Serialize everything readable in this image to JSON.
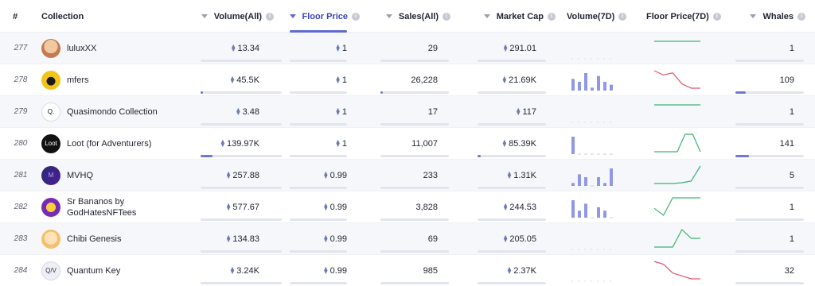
{
  "header": {
    "rank": "#",
    "collection": "Collection",
    "volume_all": "Volume(All)",
    "floor_price": "Floor Price",
    "sales_all": "Sales(All)",
    "market_cap": "Market Cap",
    "volume_7d": "Volume(7D)",
    "floor_price_7d": "Floor Price(7D)",
    "whales": "Whales",
    "info_glyph": "i"
  },
  "colors": {
    "accent": "#5e6ad2",
    "bar": "#6e78d6",
    "spark_up": "#3cb371",
    "spark_down": "#e0566b",
    "vol_bars": "#8f98e6"
  },
  "rows": [
    {
      "rank": "277",
      "name": "luluxXX",
      "avatar": "luluxXX-avatar",
      "volume": "13.34",
      "floor": "1",
      "sales": "29",
      "mcap": "291.01",
      "whales": "1",
      "volume_level": 0.0,
      "floor_level": 0.0,
      "sales_level": 0.0,
      "mcap_level": 0.0,
      "whales_level": 0.0,
      "vol7d": [],
      "floor7d": [
        1,
        1,
        1,
        1,
        1,
        1
      ],
      "trend": "up"
    },
    {
      "rank": "278",
      "name": "mfers",
      "avatar": "mfers-avatar",
      "volume": "45.5K",
      "floor": "1",
      "sales": "26,228",
      "mcap": "21.69K",
      "whales": "109",
      "volume_level": 0.03,
      "floor_level": 0.0,
      "sales_level": 0.03,
      "mcap_level": 0.0,
      "whales_level": 0.15,
      "vol7d": [
        4,
        3,
        6,
        1,
        5,
        3,
        2
      ],
      "floor7d": [
        1.4,
        1.3,
        1.35,
        1.1,
        1.0,
        1.0
      ],
      "trend": "down"
    },
    {
      "rank": "279",
      "name": "Quasimondo Collection",
      "avatar": "quasimondo-avatar",
      "volume": "3.48",
      "floor": "1",
      "sales": "17",
      "mcap": "117",
      "whales": "1",
      "volume_level": 0.0,
      "floor_level": 0.0,
      "sales_level": 0.0,
      "mcap_level": 0.0,
      "whales_level": 0.0,
      "vol7d": [],
      "floor7d": [
        1,
        1,
        1,
        1,
        1,
        1
      ],
      "trend": "up"
    },
    {
      "rank": "280",
      "name": "Loot (for Adventurers)",
      "avatar": "loot-avatar",
      "volume": "139.97K",
      "floor": "1",
      "sales": "11,007",
      "mcap": "85.39K",
      "whales": "141",
      "volume_level": 0.15,
      "floor_level": 0.0,
      "sales_level": 0.0,
      "mcap_level": 0.05,
      "whales_level": 0.2,
      "vol7d": [
        6,
        0,
        0,
        0,
        0,
        0,
        0
      ],
      "floor7d": [
        1.0,
        1.0,
        1.0,
        1.0,
        1.35,
        1.35,
        1.0
      ],
      "trend": "up"
    },
    {
      "rank": "281",
      "name": "MVHQ",
      "avatar": "mvhq-avatar",
      "volume": "257.88",
      "floor": "0.99",
      "sales": "233",
      "mcap": "1.31K",
      "whales": "5",
      "volume_level": 0.0,
      "floor_level": 0.0,
      "sales_level": 0.0,
      "mcap_level": 0.0,
      "whales_level": 0.0,
      "vol7d": [
        1,
        4,
        3,
        0,
        3,
        1,
        6
      ],
      "floor7d": [
        0.99,
        0.99,
        0.99,
        1.0,
        1.02,
        1.2
      ],
      "trend": "up"
    },
    {
      "rank": "282",
      "name": "Sr Bananos by GodHatesNFTees",
      "avatar": "bananos-avatar",
      "volume": "577.67",
      "floor": "0.99",
      "sales": "3,828",
      "mcap": "244.53",
      "whales": "1",
      "volume_level": 0.0,
      "floor_level": 0.0,
      "sales_level": 0.0,
      "mcap_level": 0.0,
      "whales_level": 0.0,
      "vol7d": [
        5,
        2,
        4,
        0,
        3,
        2,
        0
      ],
      "floor7d": [
        1.05,
        0.95,
        1.2,
        1.2,
        1.2,
        1.2
      ],
      "trend": "up"
    },
    {
      "rank": "283",
      "name": "Chibi Genesis",
      "avatar": "chibi-avatar",
      "volume": "134.83",
      "floor": "0.99",
      "sales": "69",
      "mcap": "205.05",
      "whales": "1",
      "volume_level": 0.0,
      "floor_level": 0.0,
      "sales_level": 0.0,
      "mcap_level": 0.0,
      "whales_level": 0.0,
      "vol7d": [],
      "floor7d": [
        1.0,
        1.0,
        1.0,
        1.2,
        1.1,
        1.1
      ],
      "trend": "up"
    },
    {
      "rank": "284",
      "name": "Quantum Key",
      "avatar": "quantum-avatar",
      "volume": "3.24K",
      "floor": "0.99",
      "sales": "985",
      "mcap": "2.37K",
      "whales": "32",
      "volume_level": 0.0,
      "floor_level": 0.0,
      "sales_level": 0.0,
      "mcap_level": 0.0,
      "whales_level": 0.0,
      "vol7d": [],
      "floor7d": [
        1.3,
        1.25,
        1.1,
        1.05,
        1.0,
        1.0
      ],
      "trend": "down"
    }
  ]
}
